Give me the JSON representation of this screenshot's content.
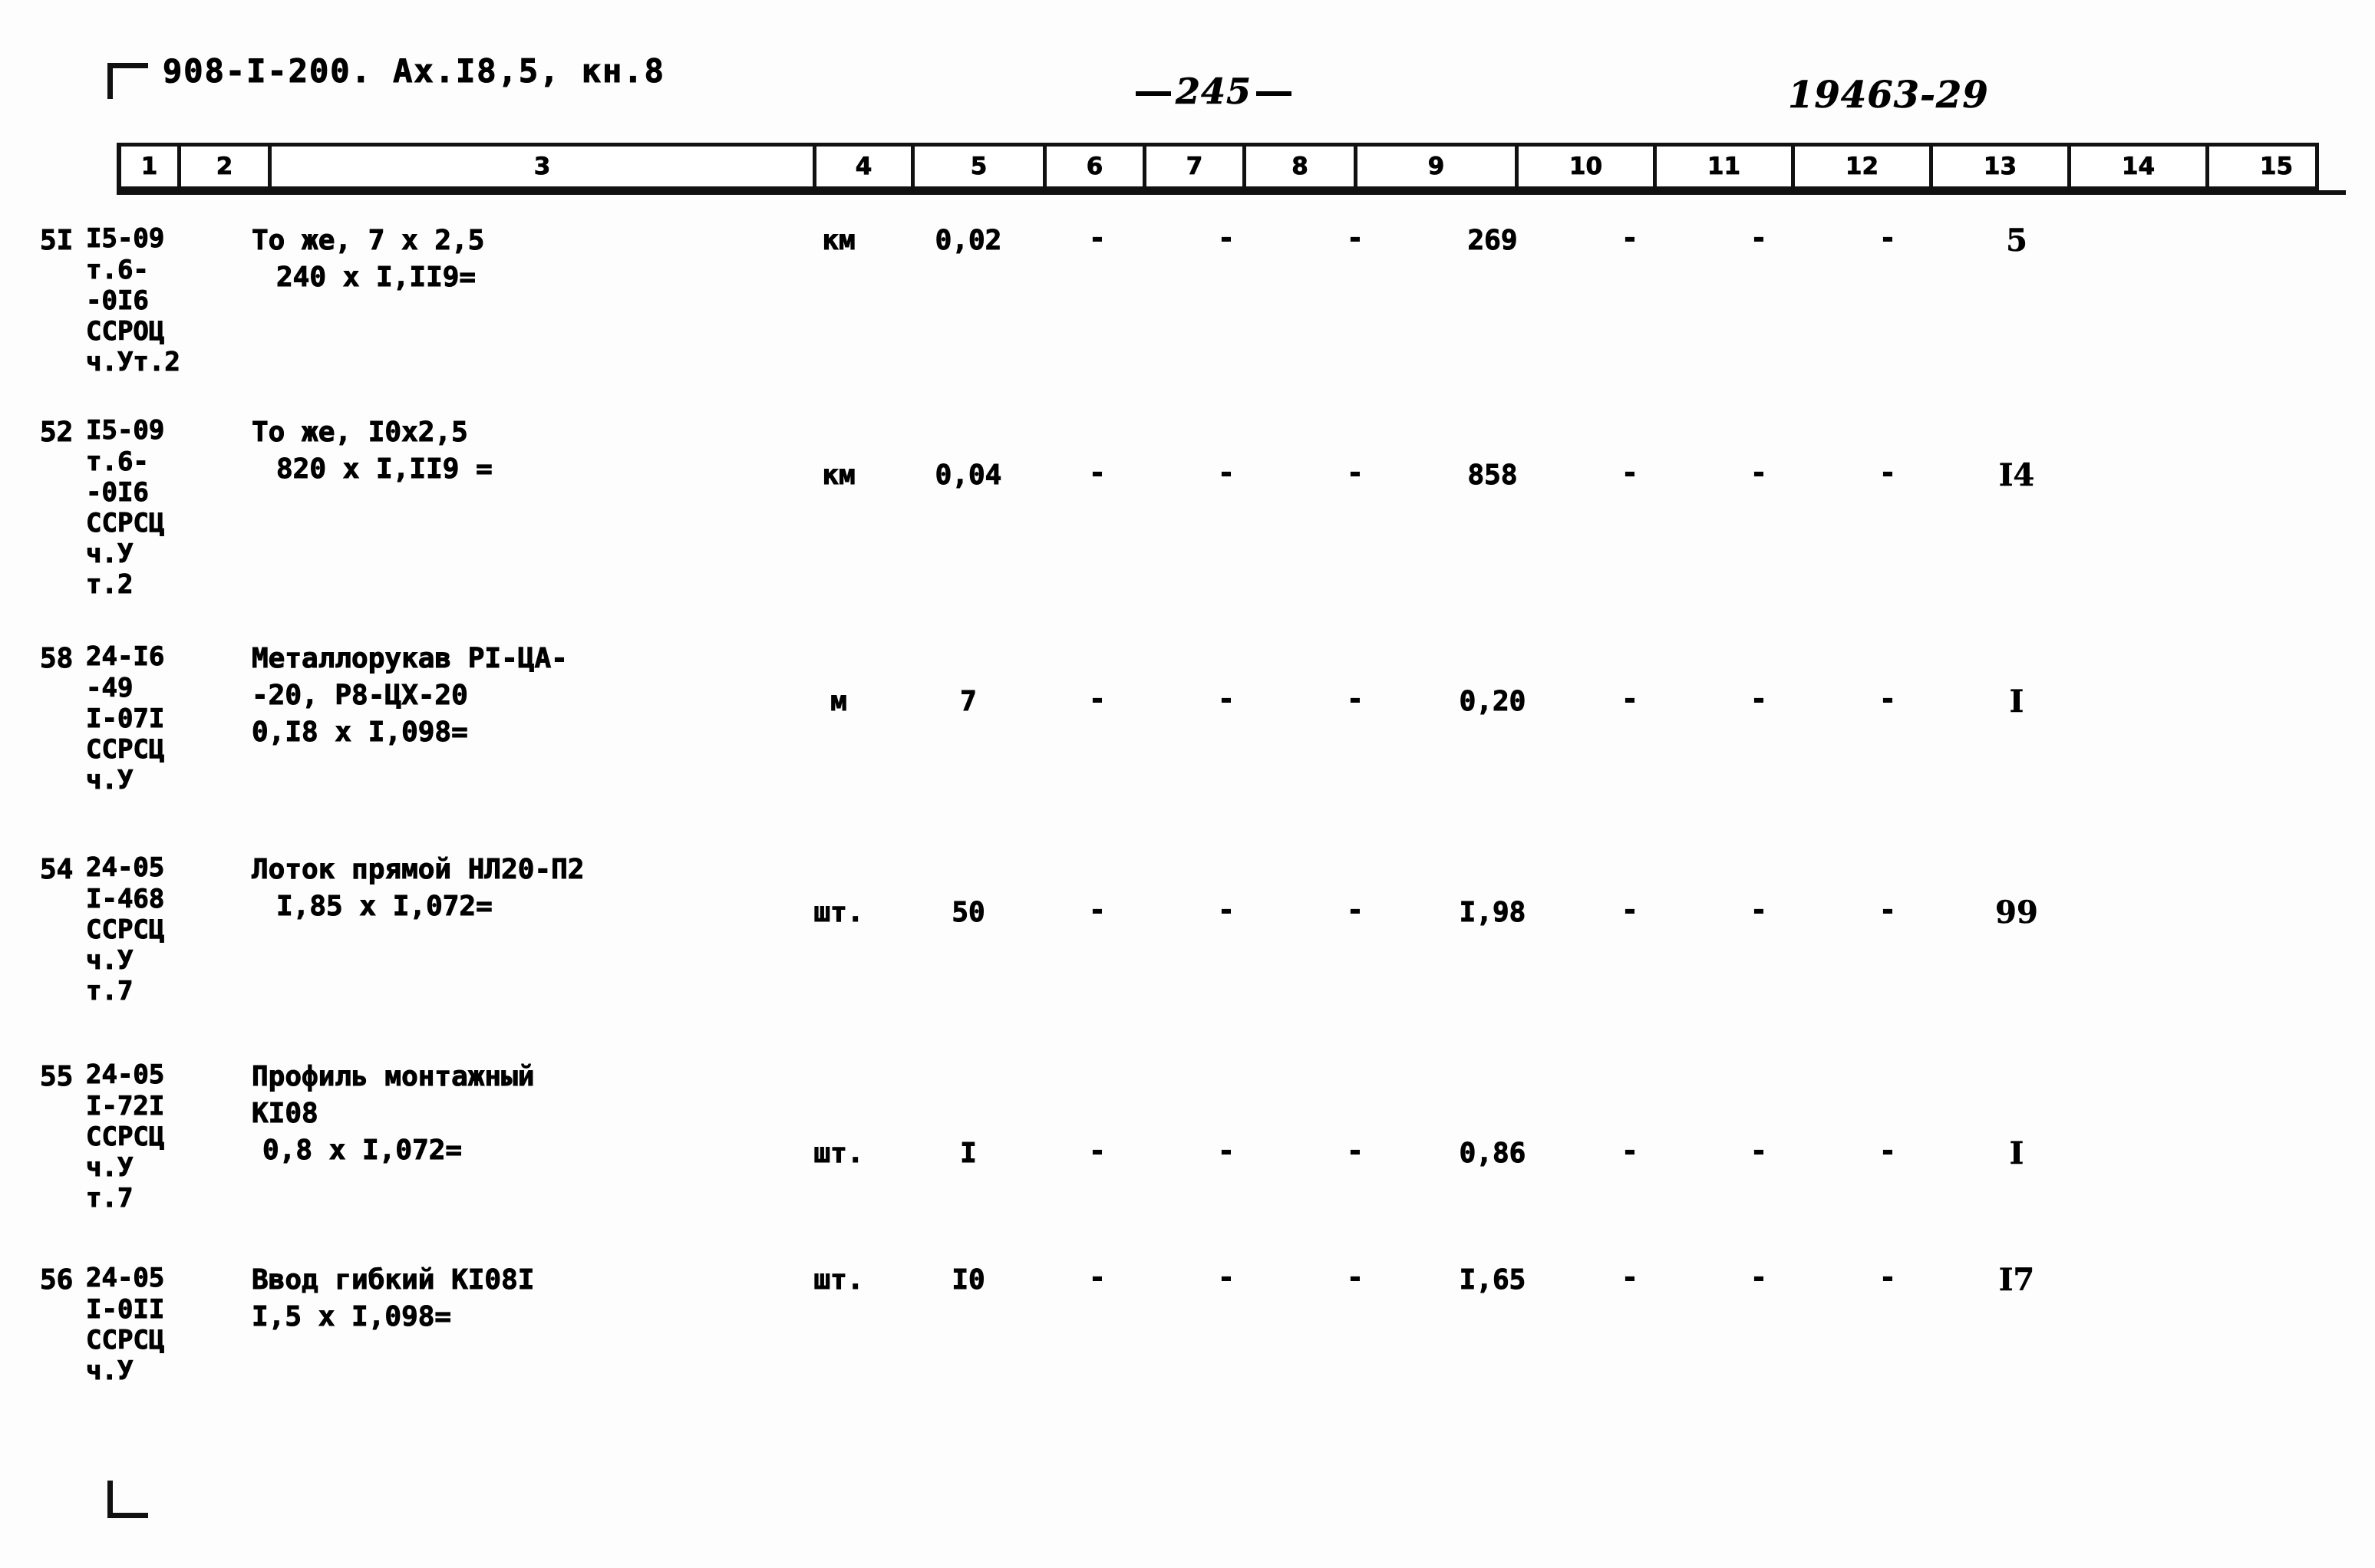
{
  "header": {
    "doc_code": "908-I-200. Ах.I8,5, кн.8",
    "page_number": "245",
    "archive_code": "19463-29"
  },
  "column_headers": [
    "1",
    "2",
    "3",
    "4",
    "5",
    "6",
    "7",
    "8",
    "9",
    "10",
    "11",
    "12",
    "13",
    "14",
    "15"
  ],
  "rows": [
    {
      "no": "5I",
      "code_lines": [
        "I5-09",
        "т.6-",
        "-0I6",
        "ССРОЦ",
        "ч.Ут.2"
      ],
      "desc_lines": [
        "То же, 7 х 2,5",
        "240 х I,II9="
      ],
      "unit": "км",
      "c5": "0,02",
      "c6": "-",
      "c7": "-",
      "c8": "-",
      "c9": "269",
      "c10": "-",
      "c11": "-",
      "c12": "-",
      "c13": "5",
      "c14": "",
      "c15": ""
    },
    {
      "no": "52",
      "code_lines": [
        "I5-09",
        "т.6-",
        "-0I6",
        "ССРСЦ",
        "ч.У",
        "т.2"
      ],
      "desc_lines": [
        "То же, I0х2,5",
        "820 х I,II9 ="
      ],
      "unit": "км",
      "c5": "0,04",
      "c6": "-",
      "c7": "-",
      "c8": "-",
      "c9": "858",
      "c10": "-",
      "c11": "-",
      "c12": "-",
      "c13": "I4",
      "c14": "",
      "c15": ""
    },
    {
      "no": "58",
      "code_lines": [
        "24-I6",
        "-49",
        "I-07I",
        "ССРСЦ",
        "ч.У"
      ],
      "desc_lines": [
        "Металлорукав РI-ЦА-",
        "-20, Р8-ЦХ-20",
        "0,I8 х I,098="
      ],
      "unit": "м",
      "c5": "7",
      "c6": "-",
      "c7": "-",
      "c8": "-",
      "c9": "0,20",
      "c10": "-",
      "c11": "-",
      "c12": "-",
      "c13": "I",
      "c14": "",
      "c15": ""
    },
    {
      "no": "54",
      "code_lines": [
        "24-05",
        "I-468",
        "ССРСЦ",
        "ч.У",
        "т.7"
      ],
      "desc_lines": [
        "Лоток прямой НЛ20-П2",
        "I,85 х I,072="
      ],
      "unit": "шт.",
      "c5": "50",
      "c6": "-",
      "c7": "-",
      "c8": "-",
      "c9": "I,98",
      "c10": "-",
      "c11": "-",
      "c12": "-",
      "c13": "99",
      "c14": "",
      "c15": ""
    },
    {
      "no": "55",
      "code_lines": [
        "24-05",
        "I-72I",
        "ССРСЦ",
        "ч.У",
        "т.7"
      ],
      "desc_lines": [
        "Профиль монтажный",
        "КI08",
        "0,8 х I,072="
      ],
      "unit": "шт.",
      "c5": "I",
      "c6": "-",
      "c7": "-",
      "c8": "-",
      "c9": "0,86",
      "c10": "-",
      "c11": "-",
      "c12": "-",
      "c13": "I",
      "c14": "",
      "c15": ""
    },
    {
      "no": "56",
      "code_lines": [
        "24-05",
        "I-0II",
        "ССРСЦ",
        "ч.У"
      ],
      "desc_lines": [
        "Ввод гибкий КI08I",
        "I,5 х I,098="
      ],
      "unit": "шт.",
      "c5": "I0",
      "c6": "-",
      "c7": "-",
      "c8": "-",
      "c9": "I,65",
      "c10": "-",
      "c11": "-",
      "c12": "-",
      "c13": "I7",
      "c14": "",
      "c15": ""
    }
  ]
}
